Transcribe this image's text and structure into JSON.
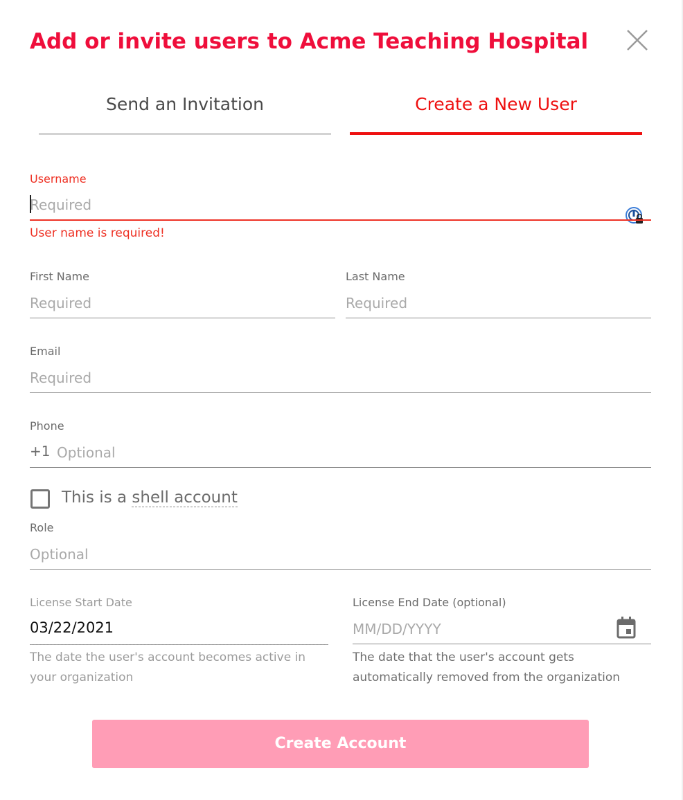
{
  "dialog": {
    "title": "Add or invite users to Acme Teaching Hospital"
  },
  "tabs": {
    "invite_label": "Send an Invitation",
    "create_label": "Create a New User",
    "active": "create"
  },
  "form": {
    "username": {
      "label": "Username",
      "placeholder": "Required",
      "value": "",
      "error": "User name is required!"
    },
    "first_name": {
      "label": "First Name",
      "placeholder": "Required",
      "value": ""
    },
    "last_name": {
      "label": "Last Name",
      "placeholder": "Required",
      "value": ""
    },
    "email": {
      "label": "Email",
      "placeholder": "Required",
      "value": ""
    },
    "phone": {
      "label": "Phone",
      "prefix": "+1",
      "placeholder": "Optional",
      "value": ""
    },
    "shell": {
      "label_prefix": "This is a ",
      "label_link": "shell account",
      "checked": false
    },
    "role": {
      "label": "Role",
      "placeholder": "Optional",
      "value": ""
    },
    "license_start": {
      "label": "License Start Date",
      "value": "03/22/2021",
      "helper": "The date the user's account becomes active in your organization"
    },
    "license_end": {
      "label": "License End Date (optional)",
      "placeholder": "MM/DD/YYYY",
      "value": "",
      "helper": "The date that the user's account gets automatically removed from the organization"
    }
  },
  "actions": {
    "create_account_label": "Create Account"
  },
  "colors": {
    "accent": "#ef0e3b",
    "tab_active": "#ee1010",
    "error": "#ee3124",
    "button_disabled": "#ff9db6"
  },
  "icons": {
    "close": "close-icon",
    "password_manager": "password-manager-icon",
    "calendar": "calendar-icon"
  }
}
